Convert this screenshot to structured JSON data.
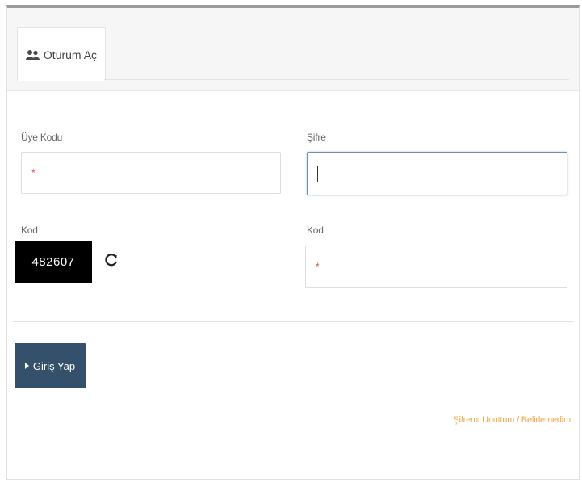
{
  "tab": {
    "label": "Oturum Aç",
    "icon": "users-icon"
  },
  "form": {
    "member_code": {
      "label": "Üye Kodu",
      "required_mark": "*"
    },
    "password": {
      "label": "Şifre"
    },
    "captcha_label": "Kod",
    "captcha_value": "482607",
    "captcha_input": {
      "label": "Kod",
      "required_mark": "*"
    },
    "refresh_icon": "refresh-icon"
  },
  "login_button": {
    "label": "Giriş Yap"
  },
  "forgot_link": {
    "label": "Şifremi Unuttum / Belirlemedim"
  },
  "colors": {
    "button": "#34506b",
    "link": "#f0a64a",
    "required": "#d9534f"
  }
}
